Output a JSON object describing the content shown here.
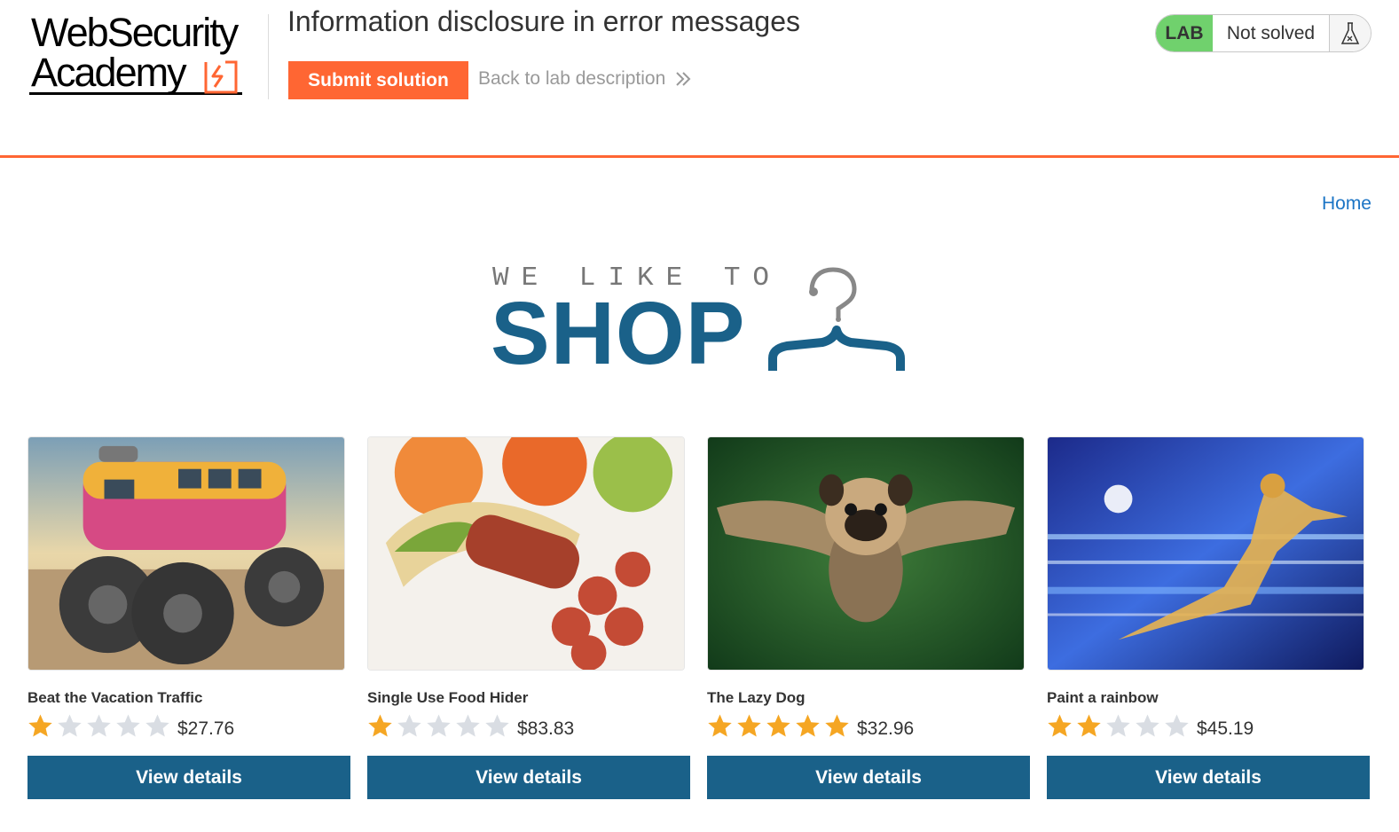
{
  "lab_header": {
    "logo": {
      "line1": "WebSecurity",
      "line2": "Academy",
      "icon": "academy-logo-mark"
    },
    "title": "Information disclosure in error messages",
    "submit_label": "Submit solution",
    "back_label": "Back to lab description",
    "back_icon": "double-chevron-right-icon",
    "status": {
      "badge": "LAB",
      "text": "Not solved",
      "icon": "flask-icon"
    },
    "accent_color": "#ff6633",
    "status_color": "#70d16d"
  },
  "nav": {
    "home_label": "Home"
  },
  "banner": {
    "small_text": "WE LIKE TO",
    "big_text": "SHOP",
    "icon": "clothes-hanger-icon",
    "color": "#1a6189"
  },
  "products": [
    {
      "name": "Beat the Vacation Traffic",
      "price": "$27.76",
      "rating": 1,
      "max_rating": 5,
      "image": "monster-truck-van",
      "button": "View details"
    },
    {
      "name": "Single Use Food Hider",
      "price": "$83.83",
      "rating": 1,
      "max_rating": 5,
      "image": "banana-sausage",
      "button": "View details"
    },
    {
      "name": "The Lazy Dog",
      "price": "$32.96",
      "rating": 5,
      "max_rating": 5,
      "image": "flying-pug",
      "button": "View details"
    },
    {
      "name": "Paint a rainbow",
      "price": "$45.19",
      "rating": 2,
      "max_rating": 5,
      "image": "light-speed-runner",
      "button": "View details"
    }
  ],
  "colors": {
    "button": "#1a6189",
    "star_filled": "#f5a623",
    "star_empty": "#d9dde3",
    "link": "#1b74c5"
  }
}
